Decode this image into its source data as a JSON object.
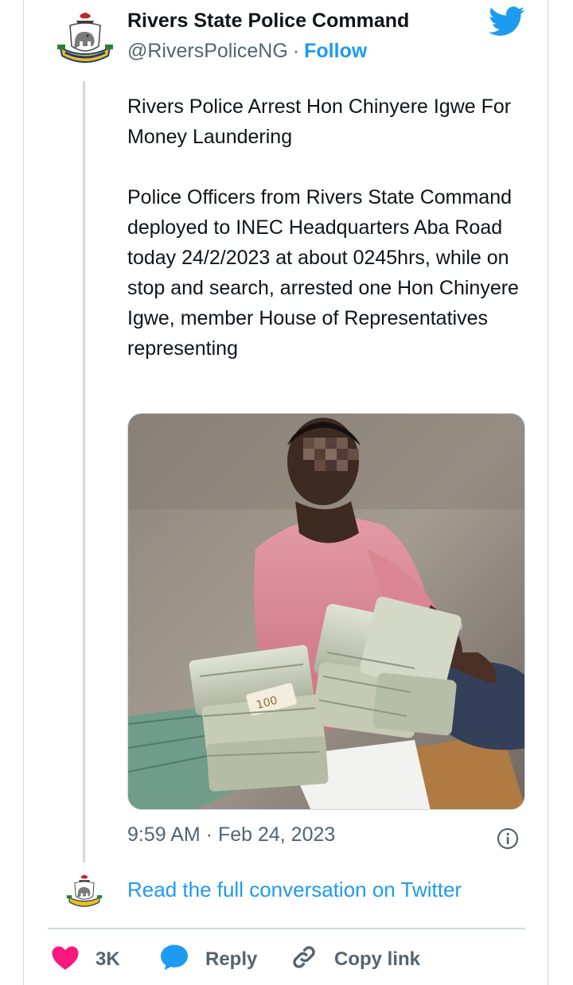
{
  "author": {
    "name": "Rivers State Police Command",
    "handle": "@RiversPoliceNG",
    "separator": "·",
    "follow_label": "Follow",
    "avatar_icon": "nigeria-police-crest-icon"
  },
  "brand": {
    "icon": "twitter-bird-icon",
    "color": "#1d9bf0"
  },
  "tweet": {
    "headline": "Rivers Police Arrest Hon Chinyere Igwe For Money Laundering",
    "body": "Police Officers from Rivers State Command deployed to INEC Headquarters Aba  Road today 24/2/2023 at about 0245hrs, while on stop and search, arrested one Hon Chinyere Igwe, member House of Representatives representing",
    "timestamp": "9:59 AM · Feb 24, 2023"
  },
  "footer": {
    "read_more": "Read the full conversation on Twitter",
    "actions": [
      {
        "icon": "heart-icon",
        "label": "3K"
      },
      {
        "icon": "reply-icon",
        "label": "Reply"
      },
      {
        "icon": "link-icon",
        "label": "Copy link"
      }
    ]
  },
  "colors": {
    "text": "#0f1419",
    "muted": "#536471",
    "border": "#cfd9de",
    "like": "#f91880",
    "link": "#1d9bf0"
  }
}
